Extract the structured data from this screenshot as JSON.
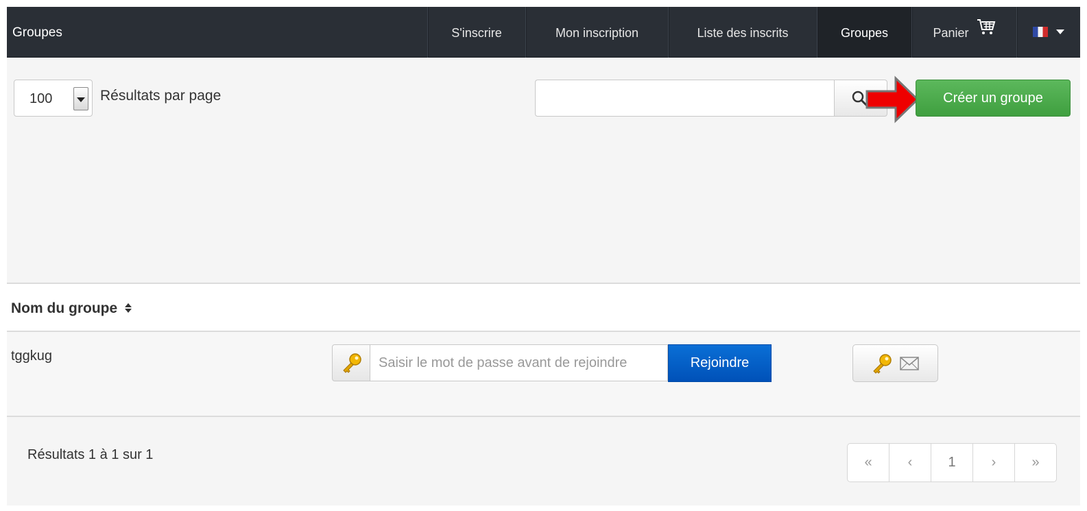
{
  "navbar": {
    "brand": "Groupes",
    "items": [
      {
        "label": "S'inscrire"
      },
      {
        "label": "Mon inscription"
      },
      {
        "label": "Liste des inscrits"
      },
      {
        "label": "Groupes"
      },
      {
        "label": "Panier"
      }
    ],
    "cart_icon": "cart-icon",
    "language_icon": "french-flag-icon"
  },
  "toolbar": {
    "per_page_value": "100",
    "per_page_label": "Résultats par page",
    "search_placeholder": "",
    "search_value": "",
    "create_label": "Créer un groupe",
    "annotation": "red-arrow-pointer"
  },
  "table": {
    "column_header": "Nom du groupe",
    "rows": [
      {
        "name": "tggkug",
        "password_placeholder": "Saisir le mot de passe avant de rejoindre",
        "join_label": "Rejoindre"
      }
    ]
  },
  "footer": {
    "results": "Résultats 1 à 1 sur 1",
    "pagination": [
      "«",
      "‹",
      "1",
      "›",
      "»"
    ]
  },
  "colors": {
    "navbar_bg": "#2a2f36",
    "create_button": "#5cb85c",
    "join_button": "#0a6fd6",
    "arrow_annotation": "#ee0000"
  }
}
